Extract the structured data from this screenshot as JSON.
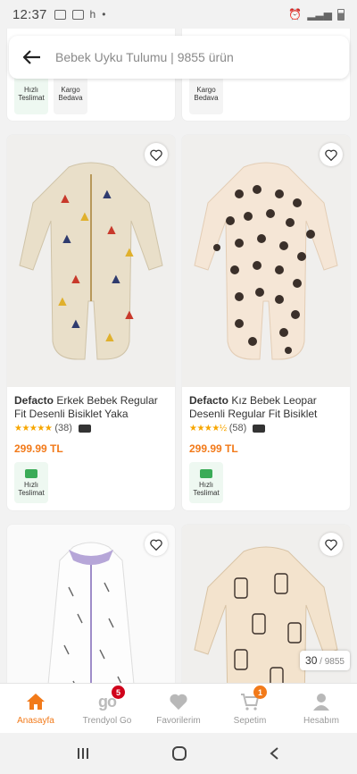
{
  "status_bar": {
    "time": "12:37",
    "extra": "h"
  },
  "search": {
    "placeholder": "Bebek Uyku Tulumu | 9855 ürün"
  },
  "top_partial": {
    "left_badges": [
      "Hızlı\nTeslimat",
      "Kargo\nBedava"
    ],
    "right_badges": [
      "Kargo\nBedava"
    ]
  },
  "products": [
    {
      "brand": "Defacto",
      "title": " Erkek Bebek Regular Fit Desenli Bisiklet Yaka Fermuarlı ...",
      "rating_count": "(38)",
      "stars": "★★★★★",
      "price": "299.99 TL",
      "badge": "Hızlı\nTeslimat",
      "image": "romper-dinosaur"
    },
    {
      "brand": "Defacto",
      "title": " Kız Bebek Leopar Desenli Regular Fit Bisiklet Yak...",
      "rating_count": "(58)",
      "stars": "★★★★½",
      "price": "299.99 TL",
      "badge": "Hızlı\nTeslimat",
      "image": "romper-leopard"
    },
    {
      "image": "sleeping-bag-pattern"
    },
    {
      "image": "romper-bottles"
    }
  ],
  "counter": {
    "current": "30",
    "total": " / 9855"
  },
  "nav": {
    "items": [
      {
        "label": "Anasayfa",
        "icon": "home-icon"
      },
      {
        "label": "Trendyol Go",
        "icon": "go-icon",
        "badge": "5"
      },
      {
        "label": "Favorilerim",
        "icon": "heart-icon"
      },
      {
        "label": "Sepetim",
        "icon": "cart-icon",
        "badge": "1"
      },
      {
        "label": "Hesabım",
        "icon": "user-icon"
      }
    ]
  },
  "colors": {
    "accent": "#f27a1a",
    "go_badge": "#d0021b",
    "green": "#3aab57"
  }
}
